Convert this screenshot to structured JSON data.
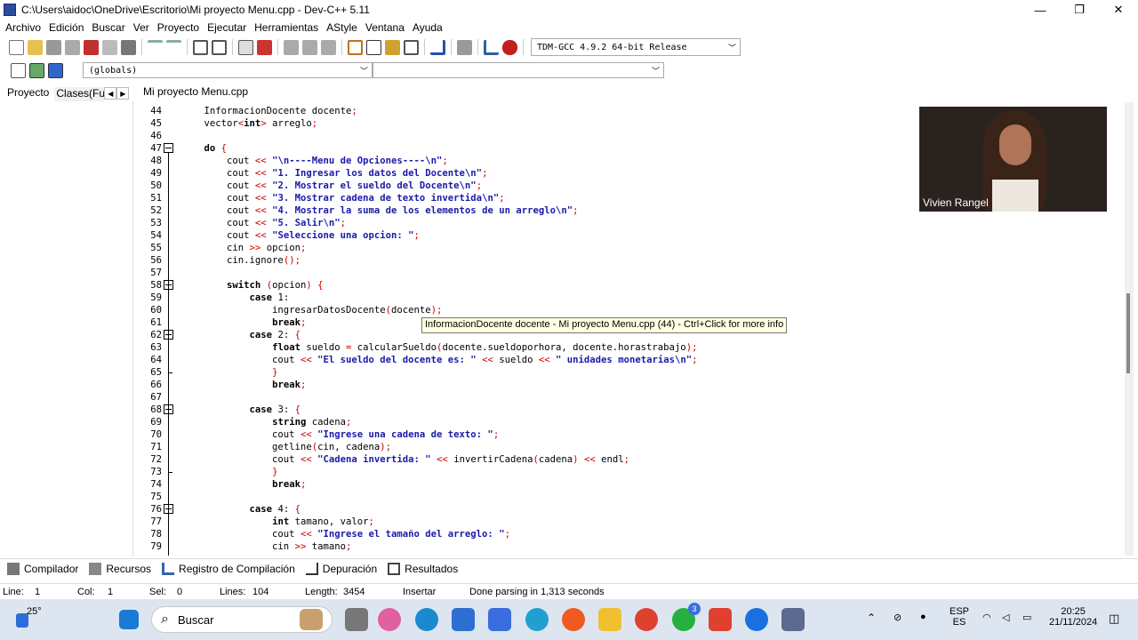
{
  "window": {
    "title": "C:\\Users\\aidoc\\OneDrive\\Escritorio\\Mi proyecto Menu.cpp - Dev-C++ 5.11",
    "minimize": "—",
    "maximize": "❐",
    "close": "✕"
  },
  "menu": [
    "Archivo",
    "Edición",
    "Buscar",
    "Ver",
    "Proyecto",
    "Ejecutar",
    "Herramientas",
    "AStyle",
    "Ventana",
    "Ayuda"
  ],
  "compiler": "TDM-GCC 4.9.2 64-bit Release",
  "scope": "(globals)",
  "panel_tabs": {
    "project": "Proyecto",
    "classes": "Clases(Fun"
  },
  "editor_tab": "Mi proyecto Menu.cpp",
  "tooltip": "InformacionDocente docente - Mi proyecto Menu.cpp (44) - Ctrl+Click for more info",
  "video": {
    "name": "Vivien Rangel"
  },
  "bottom_tabs": [
    "Compilador",
    "Recursos",
    "Registro de Compilación",
    "Depuración",
    "Resultados"
  ],
  "status": {
    "line": "Line:",
    "line_val": "1",
    "col": "Col:",
    "col_val": "1",
    "sel": "Sel:",
    "sel_val": "0",
    "lines": "Lines:",
    "lines_val": "104",
    "length": "Length:",
    "length_val": "3454",
    "mode": "Insertar",
    "message": "Done parsing in 1,313 seconds"
  },
  "taskbar": {
    "temp": "25°",
    "search": "Buscar",
    "lang1": "ESP",
    "lang2": "ES",
    "time": "20:25",
    "date": "21/11/2024",
    "badge": "3"
  },
  "code": [
    {
      "n": "44",
      "t": "    InformacionDocente docente;"
    },
    {
      "n": "45",
      "t": "    vector<int> arreglo;"
    },
    {
      "n": "46",
      "t": ""
    },
    {
      "n": "47",
      "t": "    do {"
    },
    {
      "n": "48",
      "t": "        cout << \"\\n----Menu de Opciones----\\n\";"
    },
    {
      "n": "49",
      "t": "        cout << \"1. Ingresar los datos del Docente\\n\";"
    },
    {
      "n": "50",
      "t": "        cout << \"2. Mostrar el sueldo del Docente\\n\";"
    },
    {
      "n": "51",
      "t": "        cout << \"3. Mostrar cadena de texto invertida\\n\";"
    },
    {
      "n": "52",
      "t": "        cout << \"4. Mostrar la suma de los elementos de un arreglo\\n\";"
    },
    {
      "n": "53",
      "t": "        cout << \"5. Salir\\n\";"
    },
    {
      "n": "54",
      "t": "        cout << \"Seleccione una opcion: \";"
    },
    {
      "n": "55",
      "t": "        cin >> opcion;"
    },
    {
      "n": "56",
      "t": "        cin.ignore();"
    },
    {
      "n": "57",
      "t": ""
    },
    {
      "n": "58",
      "t": "        switch (opcion) {"
    },
    {
      "n": "59",
      "t": "            case 1:"
    },
    {
      "n": "60",
      "t": "                ingresarDatosDocente(docente);"
    },
    {
      "n": "61",
      "t": "                break;"
    },
    {
      "n": "62",
      "t": "            case 2: {"
    },
    {
      "n": "63",
      "t": "                float sueldo = calcularSueldo(docente.sueldoporhora, docente.horastrabajo);"
    },
    {
      "n": "64",
      "t": "                cout << \"El sueldo del docente es: \" << sueldo << \" unidades monetarias\\n\";"
    },
    {
      "n": "65",
      "t": "                }"
    },
    {
      "n": "66",
      "t": "                break;"
    },
    {
      "n": "67",
      "t": ""
    },
    {
      "n": "68",
      "t": "            case 3: {"
    },
    {
      "n": "69",
      "t": "                string cadena;"
    },
    {
      "n": "70",
      "t": "                cout << \"Ingrese una cadena de texto: \";"
    },
    {
      "n": "71",
      "t": "                getline(cin, cadena);"
    },
    {
      "n": "72",
      "t": "                cout << \"Cadena invertida: \" << invertirCadena(cadena) << endl;"
    },
    {
      "n": "73",
      "t": "                }"
    },
    {
      "n": "74",
      "t": "                break;"
    },
    {
      "n": "75",
      "t": ""
    },
    {
      "n": "76",
      "t": "            case 4: {"
    },
    {
      "n": "77",
      "t": "                int tamano, valor;"
    },
    {
      "n": "78",
      "t": "                cout << \"Ingrese el tamaño del arreglo: \";"
    },
    {
      "n": "79",
      "t": "                cin >> tamano;"
    }
  ]
}
